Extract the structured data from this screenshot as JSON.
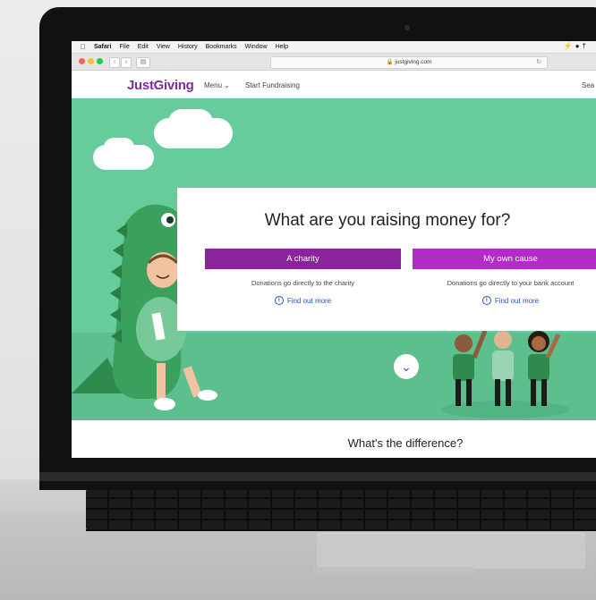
{
  "menubar": {
    "items": [
      "Safari",
      "File",
      "Edit",
      "View",
      "History",
      "Bookmarks",
      "Window",
      "Help"
    ]
  },
  "browser": {
    "url": "justgiving.com"
  },
  "site": {
    "logo": "JustGiving",
    "nav_menu": "Menu",
    "nav_start": "Start Fundraising",
    "search_partial": "Sea"
  },
  "hero": {
    "question": "What are you raising money for?",
    "option_charity": {
      "label": "A charity",
      "description": "Donations go directly to the charity",
      "link": "Find out more"
    },
    "option_own": {
      "label": "My own cause",
      "description": "Donations go directly to your bank account",
      "link": "Find out more"
    }
  },
  "below": {
    "heading": "What's the difference?"
  },
  "colors": {
    "brand_purple": "#7a2ea0",
    "charity_button": "#8a249a",
    "own_button": "#b22cc6",
    "hero_green": "#67cc9b"
  }
}
